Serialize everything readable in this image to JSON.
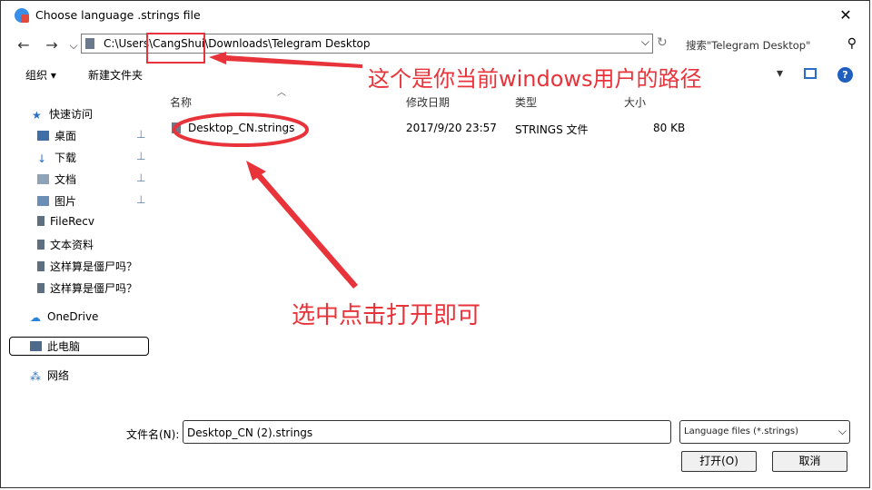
{
  "window": {
    "title": "Choose language .strings file",
    "close_glyph": "✕"
  },
  "nav": {
    "back": "←",
    "forward": "→",
    "recent": "⌵",
    "refresh": "↻"
  },
  "address": {
    "path": "C:\\Users\\CangShui\\Downloads\\Telegram Desktop",
    "dropdown": "⌵"
  },
  "search": {
    "placeholder": "搜索\"Telegram Desktop\"",
    "icon": "search-icon"
  },
  "toolbar": {
    "organize": "组织 ▾",
    "new_folder": "新建文件夹",
    "view": "▾",
    "help": "?"
  },
  "sidebar": {
    "items": [
      {
        "label": "快速访问",
        "icon": "star-icon"
      },
      {
        "label": "桌面",
        "icon": "desktop-icon",
        "pinned": true
      },
      {
        "label": "下载",
        "icon": "download-icon",
        "pinned": true
      },
      {
        "label": "文档",
        "icon": "document-icon",
        "pinned": true
      },
      {
        "label": "图片",
        "icon": "picture-icon",
        "pinned": true
      },
      {
        "label": "FileRecv",
        "icon": "folder-icon"
      },
      {
        "label": "文本资料",
        "icon": "folder-icon"
      },
      {
        "label": "这样算是僵尸吗？",
        "icon": "folder-icon"
      },
      {
        "label": "这样算是僵尸吗？",
        "icon": "folder-icon"
      },
      {
        "label": "OneDrive",
        "icon": "cloud-icon"
      },
      {
        "label": "此电脑",
        "icon": "computer-icon"
      },
      {
        "label": "网络",
        "icon": "network-icon"
      }
    ],
    "pin_glyph": "📌"
  },
  "columns": {
    "name": "名称",
    "modified": "修改日期",
    "type": "类型",
    "size": "大小"
  },
  "files": [
    {
      "name": "Desktop_CN.strings",
      "modified": "2017/9/20 23:57",
      "type": "STRINGS 文件",
      "size": "80 KB"
    }
  ],
  "footer": {
    "filename_label": "文件名(N):",
    "filename_value": "Desktop_CN (2).strings",
    "filter_value": "Language files (*.strings)",
    "open_button": "打开(O)",
    "cancel_button": "取消"
  },
  "annotations": {
    "path_note": "这个是你当前windows用户的路径",
    "select_note": "选中点击打开即可",
    "color": "#e8333a"
  }
}
